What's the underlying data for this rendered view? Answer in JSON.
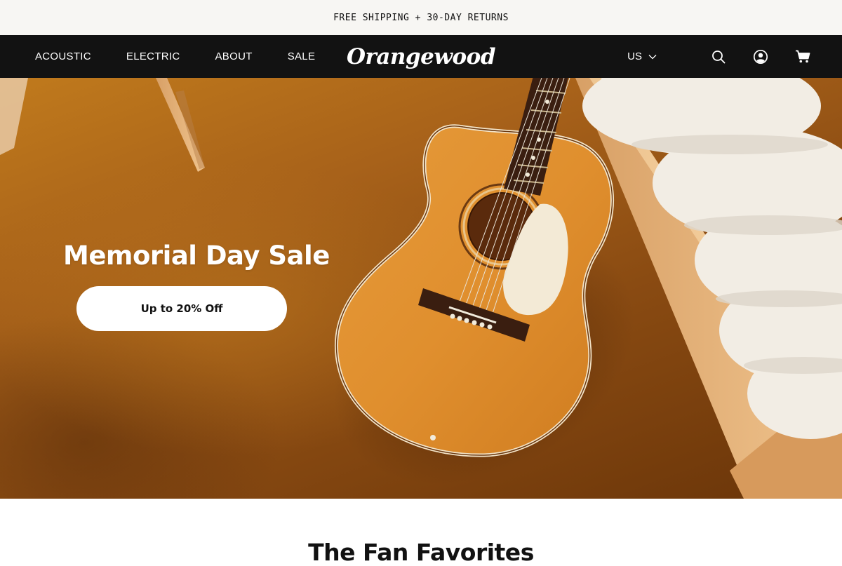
{
  "announcement": {
    "text": "FREE SHIPPING + 30-DAY RETURNS"
  },
  "nav": {
    "links": [
      {
        "label": "ACOUSTIC"
      },
      {
        "label": "ELECTRIC"
      },
      {
        "label": "ABOUT"
      },
      {
        "label": "SALE"
      }
    ],
    "logo": "Orangewood",
    "region": "US",
    "icons": [
      "search-icon",
      "account-icon",
      "cart-icon"
    ]
  },
  "hero": {
    "title": "Memorial Day Sale",
    "cta_label": "Up to 20% Off"
  },
  "section": {
    "title": "The Fan Favorites"
  },
  "colors": {
    "nav_bg": "#121212",
    "announcement_bg": "#f7f6f3",
    "hero_bg": "#a8621a",
    "cta_bg": "#ffffff"
  }
}
